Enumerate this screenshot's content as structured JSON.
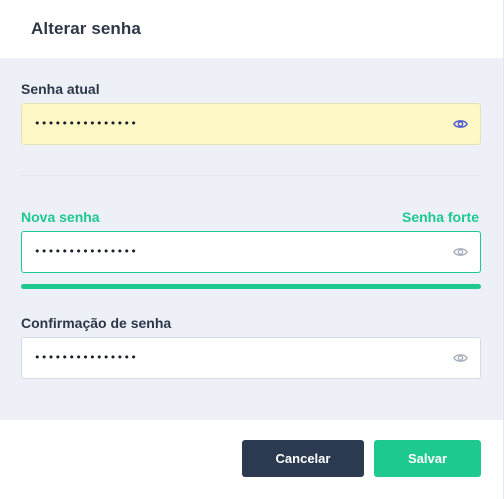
{
  "dialog": {
    "title": "Alterar senha"
  },
  "current_password": {
    "label": "Senha atual",
    "value": "•••••••••••••••",
    "toggle_icon": "eye-icon"
  },
  "new_password": {
    "label": "Nova senha",
    "strength_label": "Senha forte",
    "value": "•••••••••••••••",
    "toggle_icon": "eye-icon",
    "strength_level": 1.0
  },
  "confirm_password": {
    "label": "Confirmação de senha",
    "value": "•••••••••••••••",
    "toggle_icon": "eye-icon"
  },
  "actions": {
    "cancel_label": "Cancelar",
    "save_label": "Salvar"
  },
  "colors": {
    "accent": "#1ec98f",
    "dark_button": "#2b3a50",
    "highlight_field": "#fdf7c6",
    "active_eye": "#4b5bd5",
    "inactive_eye": "#a7afbc"
  }
}
